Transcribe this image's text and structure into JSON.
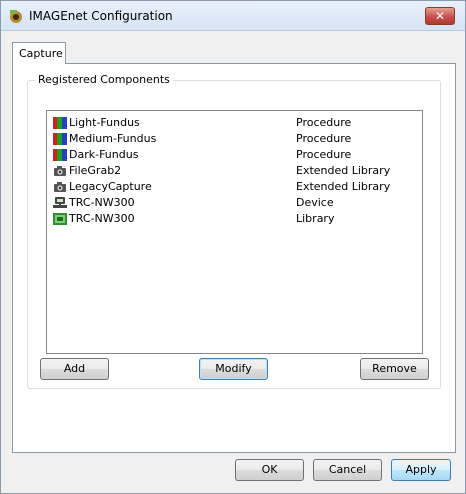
{
  "window": {
    "title": "IMAGEnet Configuration",
    "close_glyph": "✕",
    "icon": "imagenet-app-icon"
  },
  "tabs": [
    {
      "label": "Capture",
      "selected": true
    }
  ],
  "group": {
    "label": "Registered Components"
  },
  "components": [
    {
      "name": "Light-Fundus",
      "type": "Procedure",
      "icon": "procedure-icon"
    },
    {
      "name": "Medium-Fundus",
      "type": "Procedure",
      "icon": "procedure-icon"
    },
    {
      "name": "Dark-Fundus",
      "type": "Procedure",
      "icon": "procedure-icon"
    },
    {
      "name": "FileGrab2",
      "type": "Extended Library",
      "icon": "camera-icon"
    },
    {
      "name": "LegacyCapture",
      "type": "Extended Library",
      "icon": "camera-icon"
    },
    {
      "name": "TRC-NW300",
      "type": "Device",
      "icon": "device-icon"
    },
    {
      "name": "TRC-NW300",
      "type": "Library",
      "icon": "library-icon"
    }
  ],
  "list_buttons": {
    "add": "Add",
    "modify": "Modify",
    "remove": "Remove"
  },
  "dialog_buttons": {
    "ok": "OK",
    "cancel": "Cancel",
    "apply": "Apply"
  }
}
